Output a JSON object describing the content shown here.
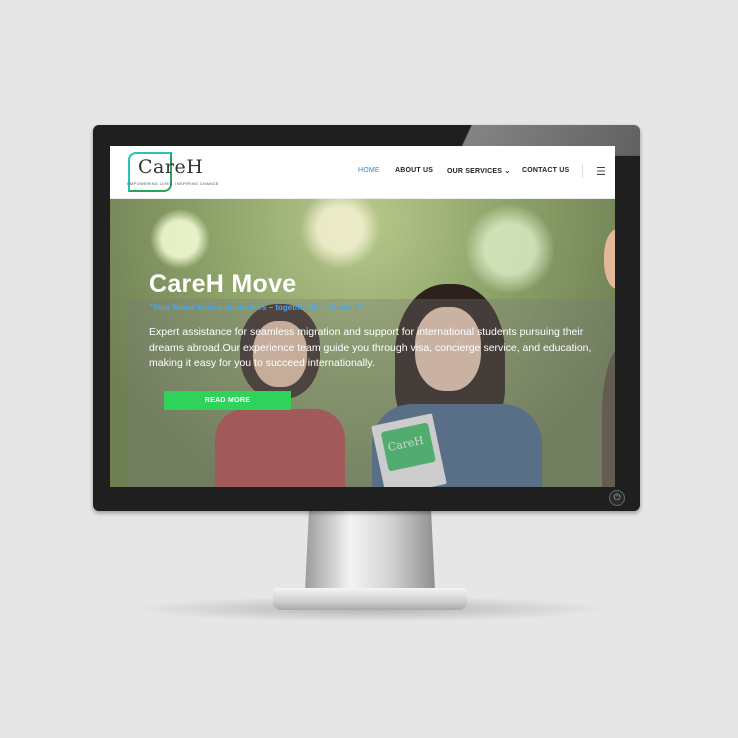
{
  "site": {
    "logo_text": "CareH",
    "logo_tagline": "EMPOWERING LIVES, INSPIRING CHANGE",
    "nav": [
      {
        "label": "HOME",
        "active": true
      },
      {
        "label": "ABOUT US",
        "active": false
      },
      {
        "label": "OUR SERVICES ⌄",
        "active": false
      },
      {
        "label": "CONTACT US",
        "active": false
      }
    ],
    "menu_icon": "☰"
  },
  "hero": {
    "title": "CareH Move",
    "subtitle": "\"Your future knows no borders – together, let's shape it\"",
    "body_lines": [
      "Expert assistance for seamless migration and support for international students pursuing their",
      "dreams abroad.Our experience team guide you through visa, concierge service, and education,",
      "making it easy for you to succeed internationally."
    ],
    "button_label": "READ MORE",
    "book_logo": "CareH"
  },
  "device": {
    "power_icon": "⏻"
  },
  "colors": {
    "accent_blue": "#2e8bd0",
    "accent_green": "#2fd25a",
    "logo_teal": "#25c4b5"
  }
}
